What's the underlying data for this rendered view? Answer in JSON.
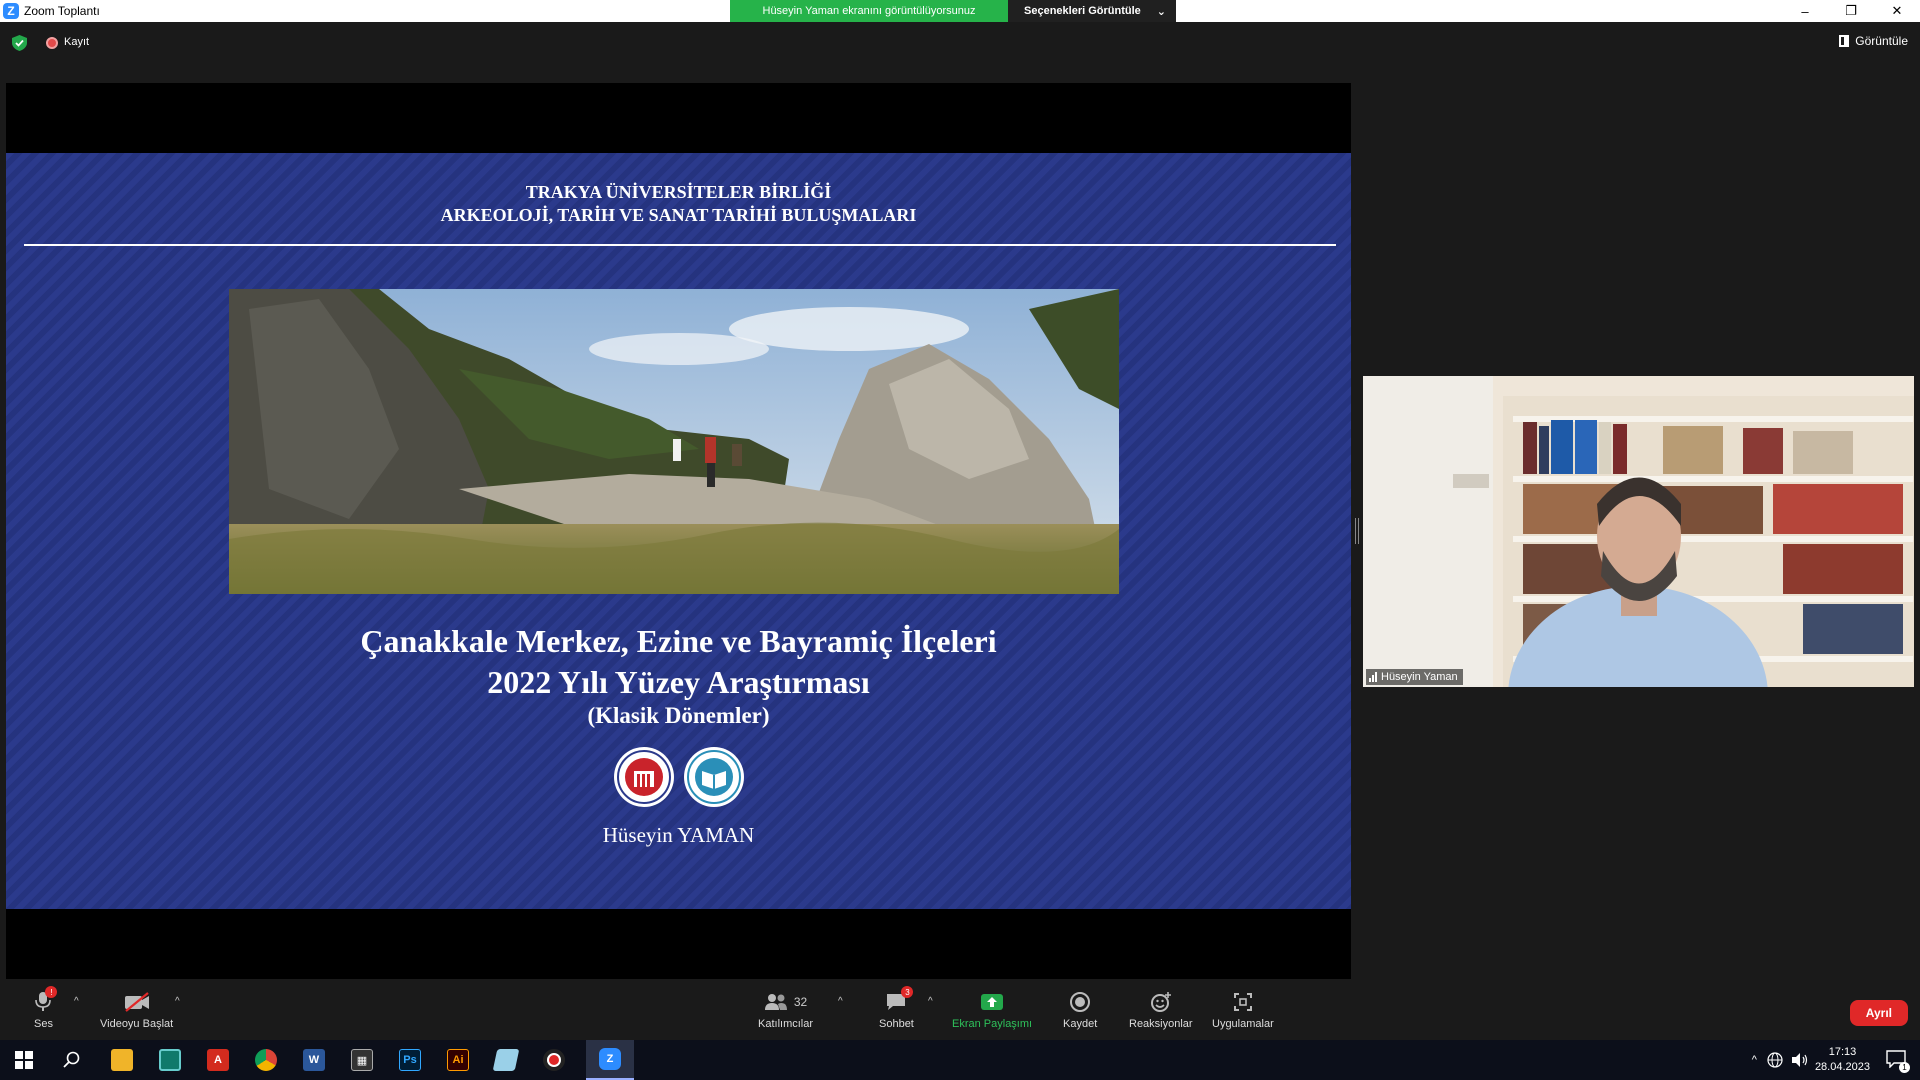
{
  "window": {
    "title": "Zoom Toplantı",
    "share_banner": "Hüseyin Yaman ekranını görüntülüyorsunuz",
    "view_options": "Seçenekleri Görüntüle",
    "minimize": "–",
    "restore": "❐",
    "close": "✕"
  },
  "topbar": {
    "recording_label": "Kayıt",
    "view_label": "Görüntüle"
  },
  "slide": {
    "header_line1": "TRAKYA ÜNİVERSİTELER BİRLİĞİ",
    "header_line2": "ARKEOLOJİ, TARİH VE SANAT TARİHİ BULUŞMALARI",
    "title_line1": "Çanakkale Merkez, Ezine ve Bayramiç İlçeleri",
    "title_line2": "2022 Yılı Yüzey Araştırması",
    "subtitle": "(Klasik Dönemler)",
    "author": "Hüseyin YAMAN"
  },
  "participant": {
    "name": "Hüseyin Yaman"
  },
  "toolbar": {
    "audio_label": "Ses",
    "audio_badge": "!",
    "video_label": "Videoyu Başlat",
    "participants_label": "Katılımcılar",
    "participants_count": "32",
    "chat_label": "Sohbet",
    "chat_badge": "3",
    "share_label": "Ekran Paylaşımı",
    "record_label": "Kaydet",
    "reactions_label": "Reaksiyonlar",
    "apps_label": "Uygulamalar",
    "leave_label": "Ayrıl"
  },
  "taskbar": {
    "time": "17:13",
    "date": "28.04.2023",
    "notification_count": "1",
    "apps": [
      "start",
      "search",
      "file-explorer",
      "task-manager",
      "acrobat",
      "chrome",
      "word",
      "media-player",
      "photoshop",
      "illustrator",
      "notes",
      "obs",
      "zoom"
    ]
  },
  "colors": {
    "slide_blue": "#2b3a8c",
    "share_green": "#26b34a",
    "leave_red": "#e02828",
    "zoom_blue": "#2d8cff"
  }
}
